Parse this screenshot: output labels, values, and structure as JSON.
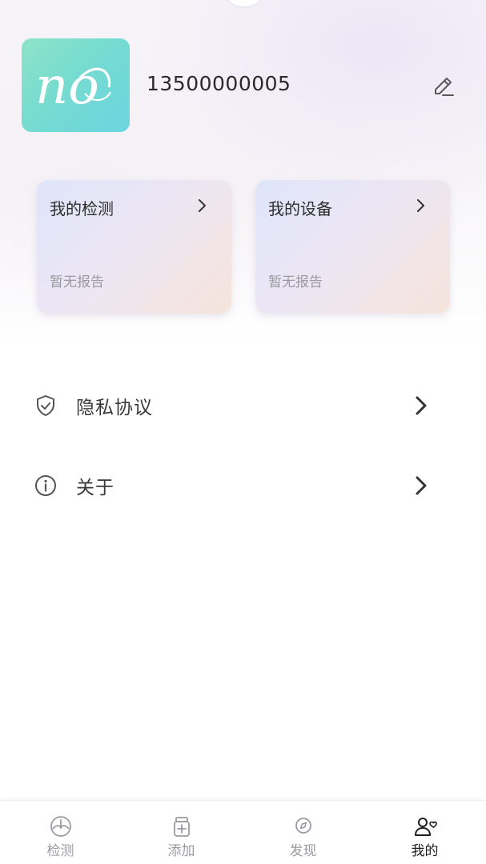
{
  "header": {
    "phone": "13500000005",
    "avatar_logo": "no"
  },
  "cards": [
    {
      "title": "我的检测",
      "subtitle": "暂无报告"
    },
    {
      "title": "我的设备",
      "subtitle": "暂无报告"
    }
  ],
  "menu": [
    {
      "label": "隐私协议",
      "icon": "shield-check-icon"
    },
    {
      "label": "关于",
      "icon": "info-icon"
    }
  ],
  "tabbar": {
    "tabs": [
      {
        "label": "检测",
        "icon": "detect-icon",
        "active": false
      },
      {
        "label": "添加",
        "icon": "add-box-icon",
        "active": false
      },
      {
        "label": "发现",
        "icon": "compass-icon",
        "active": false
      },
      {
        "label": "我的",
        "icon": "profile-icon",
        "active": true
      }
    ]
  },
  "colors": {
    "avatar_gradient_start": "#8fe3c8",
    "avatar_gradient_end": "#6bd4e0",
    "active_tab": "#1e1e1e",
    "inactive_tab": "#9b9ba3"
  }
}
